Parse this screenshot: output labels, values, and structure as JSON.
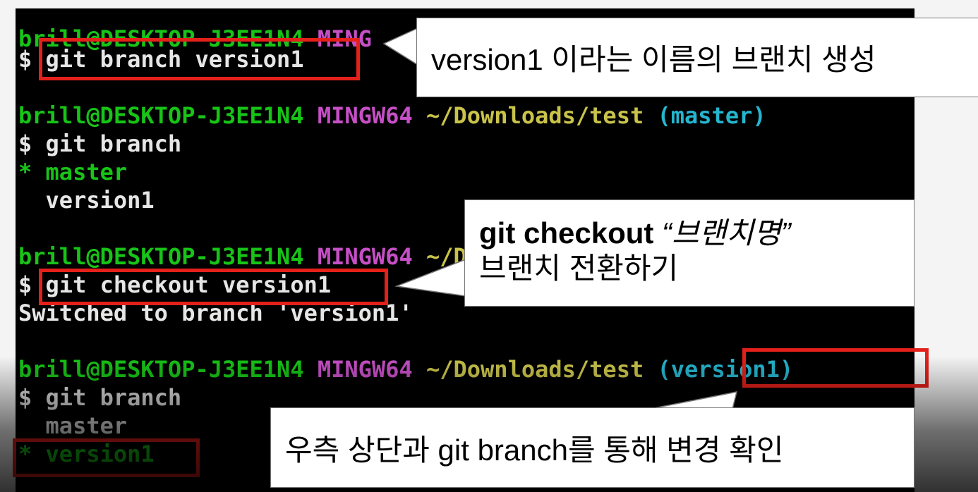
{
  "terminal": {
    "prompt_user_host": "brill@DESKTOP-J3EE1N4",
    "prompt_env": "MINGW64",
    "prompt_env_partial": "MING",
    "prompt_path": "~/Downloads/test",
    "prompt_branch_master": "(master)",
    "prompt_branch_version1": "(version1)",
    "prompt_symbol": "$",
    "cmd_create_branch": "git branch version1",
    "cmd_list_branch": "git branch",
    "list1_star": "*",
    "list1_master": "master",
    "list1_version1": "version1",
    "cmd_checkout": "git checkout version1",
    "output_switched": "Switched to branch 'version1'",
    "list2_master": "master",
    "list2_star": "*",
    "list2_version1": "version1"
  },
  "callouts": {
    "create_branch": "version1 이라는 이름의 브랜치 생성",
    "checkout_bold": "git checkout",
    "checkout_italic": "“브랜치명”",
    "checkout_line2": "브랜치 전환하기",
    "confirm": "우측 상단과 git branch를 통해 변경 확인"
  },
  "colors": {
    "prompt_green": "#17c417",
    "prompt_magenta": "#c64fc6",
    "path_yellow": "#c9c34a",
    "branch_cyan": "#25b6cf",
    "highlight_red": "#e4201a"
  }
}
